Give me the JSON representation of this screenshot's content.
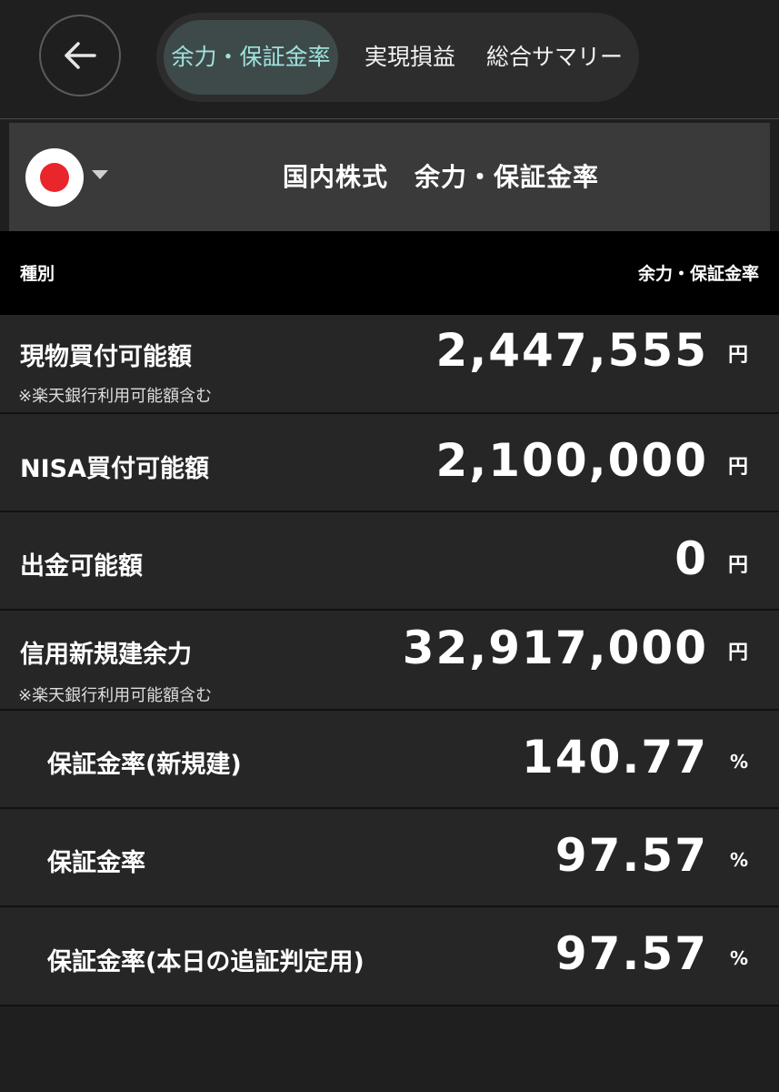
{
  "tabs": [
    {
      "label": "余力・保証金率",
      "active": true
    },
    {
      "label": "実現損益",
      "active": false
    },
    {
      "label": "総合サマリー",
      "active": false
    }
  ],
  "header": {
    "title": "国内株式　余力・保証金率",
    "flag_icon": "japan-flag-icon"
  },
  "column_header": {
    "left": "種別",
    "right": "余力・保証金率"
  },
  "rows": [
    {
      "label": "現物買付可能額",
      "note": "※楽天銀行利用可能額含む",
      "value": "2,447,555",
      "unit": "円"
    },
    {
      "label": "NISA買付可能額",
      "note": "",
      "value": "2,100,000",
      "unit": "円"
    },
    {
      "label": "出金可能額",
      "note": "",
      "value": "0",
      "unit": "円"
    },
    {
      "label": "信用新規建余力",
      "note": "※楽天銀行利用可能額含む",
      "value": "32,917,000",
      "unit": "円"
    },
    {
      "label": "保証金率(新規建)",
      "note": "",
      "value": "140.77",
      "unit": "%"
    },
    {
      "label": "保証金率",
      "note": "",
      "value": "97.57",
      "unit": "%"
    },
    {
      "label": "保証金率(本日の追証判定用)",
      "note": "",
      "value": "97.57",
      "unit": "%"
    }
  ],
  "colors": {
    "background": "#1f1f1f",
    "active_tab_text": "#9fe1dc",
    "flag_red": "#e8262b"
  }
}
